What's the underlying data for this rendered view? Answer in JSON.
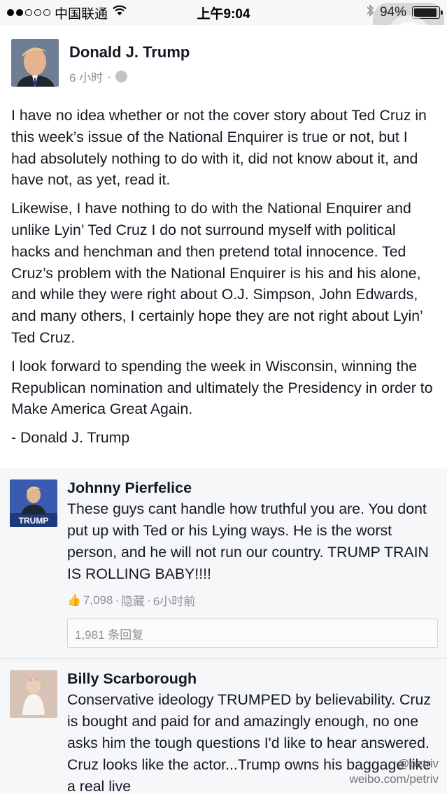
{
  "status_bar": {
    "carrier": "中国联通",
    "time": "上午9:04",
    "battery": "94%",
    "battery_level": 0.94
  },
  "post": {
    "author": "Donald J. Trump",
    "time": "6 小时",
    "paragraphs": [
      "I have no idea whether or not the cover story about Ted Cruz in this week’s issue of the National Enquirer is true or not, but I had absolutely nothing to do with it, did not know about it, and have not, as yet, read it.",
      "Likewise, I have nothing to do with the National Enquirer and unlike Lyin’ Ted Cruz I do not surround myself with political hacks and henchman and then pretend total innocence. Ted Cruz’s problem with the National Enquirer is his and his alone, and while they were right about O.J. Simpson, John Edwards, and many others, I certainly hope they are not right about Lyin’ Ted Cruz.",
      "I look forward to spending the week in Wisconsin, winning the Republican nomination and ultimately the Presidency in order to Make America Great Again.",
      "- Donald J. Trump"
    ]
  },
  "comments": [
    {
      "name": "Johnny Pierfelice",
      "avatar_label": "TRUMP",
      "text": "These guys cant handle how truthful you are. You dont put up with Ted or his Lying ways. He is the worst person, and he will not run our country. TRUMP TRAIN IS ROLLING BABY!!!!",
      "likes": "7,098",
      "hide": "隐藏",
      "time": "6小时前",
      "replies": "1,981 条回复"
    },
    {
      "name": "Billy Scarborough",
      "text": "Conservative ideology TRUMPED by believability. Cruz is bought and paid for and amazingly enough, no one asks him the tough questions I'd like to hear answered. Cruz looks like the actor...Trump owns his baggage like a real live"
    }
  ],
  "watermark": {
    "handle": "@petriv",
    "url": "weibo.com/petriv"
  }
}
